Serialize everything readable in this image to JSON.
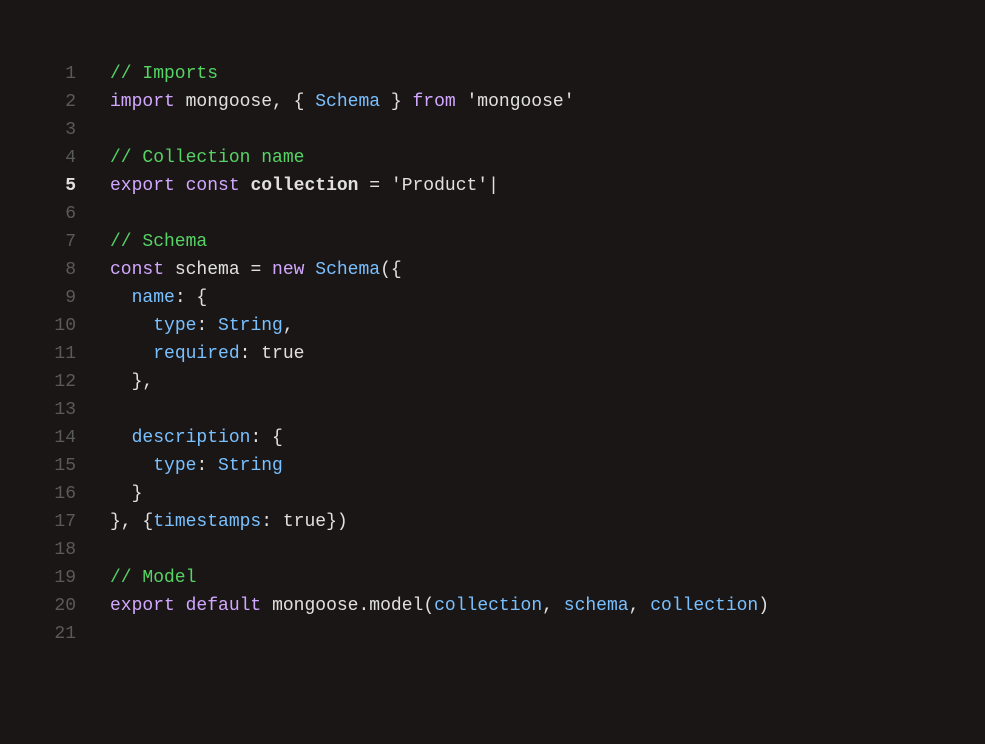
{
  "code": {
    "active_line": 5,
    "lines": [
      {
        "num": 1,
        "tokens": [
          {
            "cls": "tok-comment",
            "text": "// Imports"
          }
        ]
      },
      {
        "num": 2,
        "tokens": [
          {
            "cls": "tok-keyword",
            "text": "import"
          },
          {
            "cls": "tok-ident",
            "text": " mongoose"
          },
          {
            "cls": "tok-punct",
            "text": ", { "
          },
          {
            "cls": "tok-type",
            "text": "Schema"
          },
          {
            "cls": "tok-punct",
            "text": " } "
          },
          {
            "cls": "tok-keyword",
            "text": "from"
          },
          {
            "cls": "tok-punct",
            "text": " "
          },
          {
            "cls": "tok-string",
            "text": "'mongoose'"
          }
        ]
      },
      {
        "num": 3,
        "tokens": []
      },
      {
        "num": 4,
        "tokens": [
          {
            "cls": "tok-comment",
            "text": "// Collection name"
          }
        ]
      },
      {
        "num": 5,
        "tokens": [
          {
            "cls": "tok-keyword",
            "text": "export"
          },
          {
            "cls": "tok-punct",
            "text": " "
          },
          {
            "cls": "tok-keyword",
            "text": "const"
          },
          {
            "cls": "tok-punct",
            "text": " "
          },
          {
            "cls": "tok-ident tok-bold",
            "text": "collection"
          },
          {
            "cls": "tok-punct",
            "text": " = "
          },
          {
            "cls": "tok-string",
            "text": "'Product'"
          },
          {
            "cls": "tok-cursor",
            "text": "|"
          }
        ]
      },
      {
        "num": 6,
        "tokens": []
      },
      {
        "num": 7,
        "tokens": [
          {
            "cls": "tok-comment",
            "text": "// Schema"
          }
        ]
      },
      {
        "num": 8,
        "tokens": [
          {
            "cls": "tok-keyword",
            "text": "const"
          },
          {
            "cls": "tok-punct",
            "text": " "
          },
          {
            "cls": "tok-ident",
            "text": "schema"
          },
          {
            "cls": "tok-punct",
            "text": " = "
          },
          {
            "cls": "tok-keyword",
            "text": "new"
          },
          {
            "cls": "tok-punct",
            "text": " "
          },
          {
            "cls": "tok-type",
            "text": "Schema"
          },
          {
            "cls": "tok-punct",
            "text": "({"
          }
        ]
      },
      {
        "num": 9,
        "tokens": [
          {
            "cls": "tok-punct",
            "text": "  "
          },
          {
            "cls": "tok-prop",
            "text": "name"
          },
          {
            "cls": "tok-punct",
            "text": ": {"
          }
        ]
      },
      {
        "num": 10,
        "tokens": [
          {
            "cls": "tok-punct",
            "text": "    "
          },
          {
            "cls": "tok-prop",
            "text": "type"
          },
          {
            "cls": "tok-punct",
            "text": ": "
          },
          {
            "cls": "tok-type",
            "text": "String"
          },
          {
            "cls": "tok-punct",
            "text": ","
          }
        ]
      },
      {
        "num": 11,
        "tokens": [
          {
            "cls": "tok-punct",
            "text": "    "
          },
          {
            "cls": "tok-prop",
            "text": "required"
          },
          {
            "cls": "tok-punct",
            "text": ": "
          },
          {
            "cls": "tok-ident",
            "text": "true"
          }
        ]
      },
      {
        "num": 12,
        "tokens": [
          {
            "cls": "tok-punct",
            "text": "  },"
          }
        ]
      },
      {
        "num": 13,
        "tokens": []
      },
      {
        "num": 14,
        "tokens": [
          {
            "cls": "tok-punct",
            "text": "  "
          },
          {
            "cls": "tok-prop",
            "text": "description"
          },
          {
            "cls": "tok-punct",
            "text": ": {"
          }
        ]
      },
      {
        "num": 15,
        "tokens": [
          {
            "cls": "tok-punct",
            "text": "    "
          },
          {
            "cls": "tok-prop",
            "text": "type"
          },
          {
            "cls": "tok-punct",
            "text": ": "
          },
          {
            "cls": "tok-type",
            "text": "String"
          }
        ]
      },
      {
        "num": 16,
        "tokens": [
          {
            "cls": "tok-punct",
            "text": "  }"
          }
        ]
      },
      {
        "num": 17,
        "tokens": [
          {
            "cls": "tok-punct",
            "text": "}, {"
          },
          {
            "cls": "tok-prop",
            "text": "timestamps"
          },
          {
            "cls": "tok-punct",
            "text": ": "
          },
          {
            "cls": "tok-ident",
            "text": "true"
          },
          {
            "cls": "tok-punct",
            "text": "})"
          }
        ]
      },
      {
        "num": 18,
        "tokens": []
      },
      {
        "num": 19,
        "tokens": [
          {
            "cls": "tok-comment",
            "text": "// Model"
          }
        ]
      },
      {
        "num": 20,
        "tokens": [
          {
            "cls": "tok-keyword",
            "text": "export"
          },
          {
            "cls": "tok-punct",
            "text": " "
          },
          {
            "cls": "tok-keyword",
            "text": "default"
          },
          {
            "cls": "tok-punct",
            "text": " "
          },
          {
            "cls": "tok-ident",
            "text": "mongoose"
          },
          {
            "cls": "tok-punct",
            "text": "."
          },
          {
            "cls": "tok-ident",
            "text": "model"
          },
          {
            "cls": "tok-punct",
            "text": "("
          },
          {
            "cls": "tok-prop",
            "text": "collection"
          },
          {
            "cls": "tok-punct",
            "text": ", "
          },
          {
            "cls": "tok-prop",
            "text": "schema"
          },
          {
            "cls": "tok-punct",
            "text": ", "
          },
          {
            "cls": "tok-prop",
            "text": "collection"
          },
          {
            "cls": "tok-punct",
            "text": ")"
          }
        ]
      },
      {
        "num": 21,
        "tokens": []
      }
    ]
  }
}
